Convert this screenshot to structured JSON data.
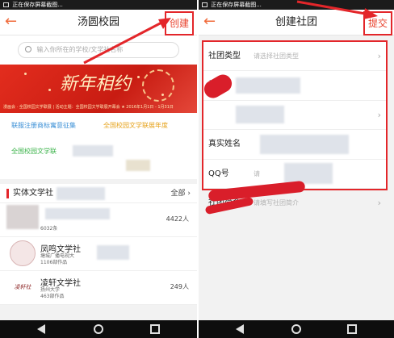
{
  "status_bar": {
    "text": "正在保存屏幕截图..."
  },
  "left_screen": {
    "title": "汤圆校园",
    "create_label": "创建",
    "search": {
      "placeholder": "输入你所在的学校/文学社名称"
    },
    "banner": {
      "headline": "新年相约",
      "caption": "漫画会 · 全国校园文学联展 | 活动主题：全国校园文学联展开幕会 ★ 2016年1月1日 - 1月31日"
    },
    "notices": [
      "联服注册商标寓意征集",
      "全国校园文学联展年度",
      "全国校园文学联"
    ],
    "section": {
      "title": "实体文学社",
      "all_label": "全部"
    },
    "clubs": [
      {
        "name": "",
        "sub1": "",
        "sub2": "6032条",
        "count": "4422人"
      },
      {
        "name": "凤鸣文学社",
        "sub1": "塘城广播电视大",
        "sub2": "1106部作品",
        "count": ""
      },
      {
        "name": "凌轩文学社",
        "sub1": "扬州大学",
        "sub2": "463部作品",
        "count": "249人",
        "logo_text": "凌轩社"
      }
    ]
  },
  "right_screen": {
    "title": "创建社团",
    "submit_label": "提交",
    "form_rows": [
      {
        "label": "社团类型",
        "hint": "请选择社团类型",
        "chevron": "›"
      },
      {
        "label": "社",
        "hint": "",
        "chevron": ""
      },
      {
        "label": "",
        "hint": "",
        "chevron": "›"
      },
      {
        "label": "真实姓名",
        "hint": "",
        "chevron": ""
      },
      {
        "label": "QQ号",
        "hint": "请",
        "chevron": ""
      },
      {
        "label": "社团简介",
        "hint": "请填写社团简介",
        "chevron": "›"
      }
    ]
  },
  "icons": {
    "back": "arrow-left-icon",
    "search": "search-icon",
    "chevron": "chevron-right-icon"
  },
  "colors": {
    "accent": "#e3262a",
    "back_arrow": "#f06a3a",
    "blue_text": "#3a8fd6",
    "yellow_text": "#e6a21a",
    "green_text": "#3bb34a"
  }
}
